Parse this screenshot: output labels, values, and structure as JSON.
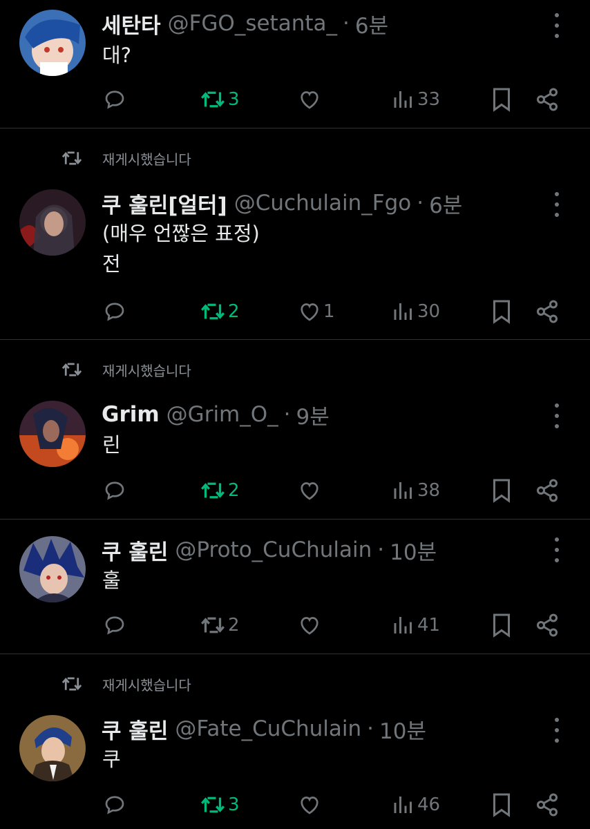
{
  "repost_label": "재게시했습니다",
  "colors": {
    "background": "#000000",
    "secondary": "#71767b",
    "repost_active": "#00ba7c",
    "divider": "#2f3336"
  },
  "tweets": [
    {
      "name": "세탄타",
      "handle": "@FGO_setanta_",
      "time": "6분",
      "text": "대?",
      "reposts": "3",
      "likes": "",
      "views": "33",
      "reposted": true,
      "repost_header": false,
      "avatar": "blue-haired-character"
    },
    {
      "name": "쿠 훌린[얼터]",
      "handle": "@Cuchulain_Fgo",
      "time": "6분",
      "text": "(매우 언짢은 표정)\n전",
      "reposts": "2",
      "likes": "1",
      "views": "30",
      "reposted": true,
      "repost_header": true,
      "avatar": "dark-haired-character"
    },
    {
      "name": "Grim",
      "handle": "@Grim_O_",
      "time": "9분",
      "text": "린",
      "reposts": "2",
      "likes": "",
      "views": "38",
      "reposted": true,
      "repost_header": true,
      "avatar": "red-sky-character"
    },
    {
      "name": "쿠 훌린",
      "handle": "@Proto_CuChulain",
      "time": "10분",
      "text": "훌",
      "reposts": "2",
      "likes": "",
      "views": "41",
      "reposted": false,
      "repost_header": false,
      "avatar": "spiky-blue-haired-character"
    },
    {
      "name": "쿠 훌린",
      "handle": "@Fate_CuChulain",
      "time": "10분",
      "text": "쿠",
      "reposts": "3",
      "likes": "",
      "views": "46",
      "reposted": true,
      "repost_header": true,
      "avatar": "suited-blue-haired-character"
    }
  ]
}
